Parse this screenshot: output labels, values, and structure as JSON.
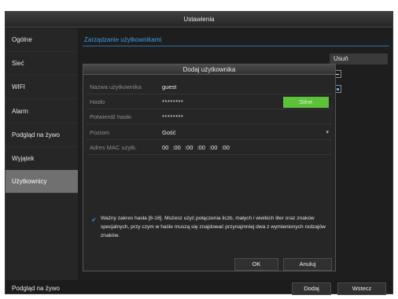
{
  "window": {
    "title": "Ustawienia"
  },
  "sidebar": {
    "items": [
      {
        "label": "Ogólne"
      },
      {
        "label": "Sieć"
      },
      {
        "label": "WIFI"
      },
      {
        "label": "Alarm"
      },
      {
        "label": "Podgląd na żywo"
      },
      {
        "label": "Wyjątek"
      },
      {
        "label": "Użytkownicy",
        "active": true
      }
    ],
    "bottom_label": "Podgląd na żywo"
  },
  "content": {
    "tab_label": "Zarządzanie użytkownikami",
    "delete_column": "Usuń"
  },
  "dialog": {
    "title": "Dodaj użytkownika",
    "fields": {
      "username": {
        "label": "Nazwa użytkownika",
        "value": "guest"
      },
      "password": {
        "label": "Hasło",
        "value": "********",
        "strength": "Silne"
      },
      "confirm": {
        "label": "Potwierdź hasło",
        "value": "********"
      },
      "level": {
        "label": "Poziom",
        "value": "Gość"
      },
      "mac": {
        "label": "Adres MAC użytk.",
        "value": "00 :00 :00 :00 :00 :00"
      }
    },
    "info_text": "Ważny zakres hasła [8-16]. Możesz użyć połączenia liczb, małych i wielkich liter oraz znaków specjalnych, przy czym w haśle muszą się znajdować przynajmniej dwa z wymienionych rodzajów znaków.",
    "ok_label": "OK",
    "cancel_label": "Anuluj"
  },
  "footer": {
    "add_label": "Dodaj",
    "back_label": "Wstecz"
  },
  "icons": {
    "check": "checkmark-icon",
    "chevron": "chevron-down-icon"
  },
  "colors": {
    "accent": "#3aa0e0",
    "strength_good": "#5cc23a",
    "active_sidebar": "#707070"
  }
}
